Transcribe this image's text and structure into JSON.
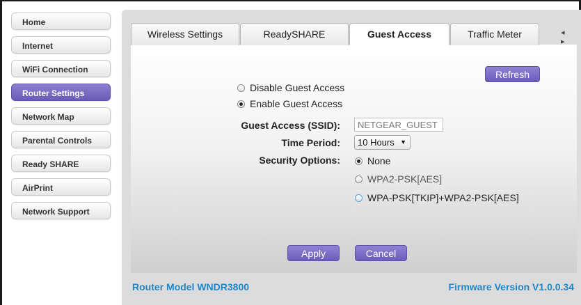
{
  "sidebar": {
    "items": [
      {
        "label": "Home"
      },
      {
        "label": "Internet"
      },
      {
        "label": "WiFi Connection"
      },
      {
        "label": "Router Settings"
      },
      {
        "label": "Network Map"
      },
      {
        "label": "Parental Controls"
      },
      {
        "label": "Ready SHARE"
      },
      {
        "label": "AirPrint"
      },
      {
        "label": "Network Support"
      }
    ],
    "active_index": 3
  },
  "tabs": [
    {
      "label": "Wireless Settings"
    },
    {
      "label": "ReadySHARE"
    },
    {
      "label": "Guest Access"
    },
    {
      "label": "Traffic Meter"
    }
  ],
  "active_tab": "Guest Access",
  "tab_arrows": "◂ ▸",
  "refresh_label": "Refresh",
  "guest_access": {
    "disable_label": "Disable Guest Access",
    "enable_label": "Enable Guest Access",
    "selected": "enable",
    "ssid_label": "Guest Access (SSID):",
    "ssid_value": "NETGEAR_GUEST",
    "time_period_label": "Time Period:",
    "time_period_value": "10 Hours",
    "security_label": "Security Options:",
    "security_options": [
      {
        "label": "None",
        "checked": true
      },
      {
        "label": "WPA2-PSK[AES]",
        "checked": false
      },
      {
        "label": "WPA-PSK[TKIP]+WPA2-PSK[AES]",
        "checked": false
      }
    ]
  },
  "apply_label": "Apply",
  "cancel_label": "Cancel",
  "footer": {
    "model": "Router Model WNDR3800",
    "firmware": "Firmware Version V1.0.0.34"
  },
  "colors": {
    "accent_purple": "#7a6dc6",
    "footer_blue": "#1f86c6",
    "panel_gray": "#dcdcdc"
  }
}
